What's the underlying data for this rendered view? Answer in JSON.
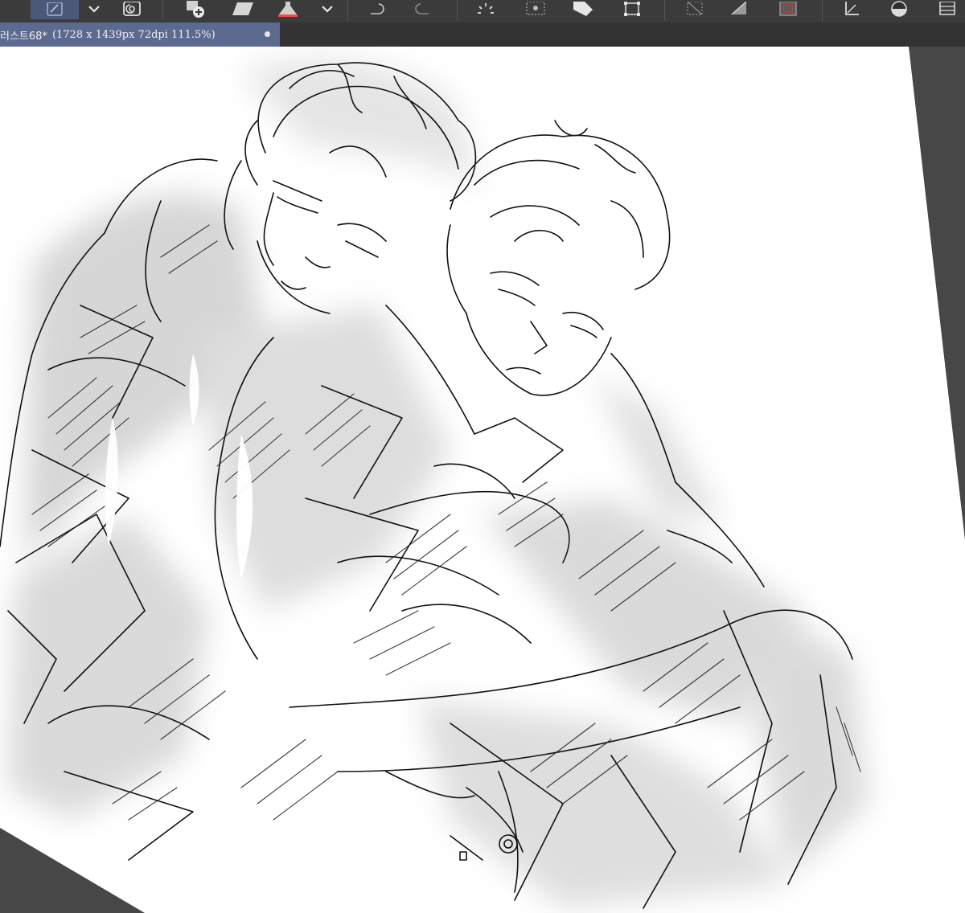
{
  "toolbar": {
    "buttons": [
      {
        "icon": "pen-pressure-icon",
        "active": true
      },
      {
        "icon": "chevron-down-icon"
      },
      {
        "icon": "spiral-icon"
      },
      {
        "icon": "new-layer-icon"
      },
      {
        "icon": "fill-shape-icon"
      },
      {
        "icon": "flask-icon"
      },
      {
        "icon": "chevron-down-icon"
      },
      {
        "icon": "undo-icon"
      },
      {
        "icon": "redo-icon"
      },
      {
        "icon": "loading-icon"
      },
      {
        "icon": "sparkle-frame-icon"
      },
      {
        "icon": "tag-icon"
      },
      {
        "icon": "transform-icon"
      },
      {
        "icon": "deselect-icon"
      },
      {
        "icon": "fill-selection-icon"
      },
      {
        "icon": "layer-frame-icon"
      },
      {
        "icon": "ruler-icon"
      },
      {
        "icon": "half-circle-icon"
      },
      {
        "icon": "grid-icon"
      }
    ]
  },
  "document_tab": {
    "title": "러스트68*",
    "info": "(1728 x 1439px 72dpi 111.5%)"
  },
  "colors": {
    "toolbar_bg": "#3b3b3b",
    "tab_active": "#5c6a8f",
    "workspace_bg": "#474747",
    "paper": "#ffffff",
    "ink": "#111111"
  }
}
